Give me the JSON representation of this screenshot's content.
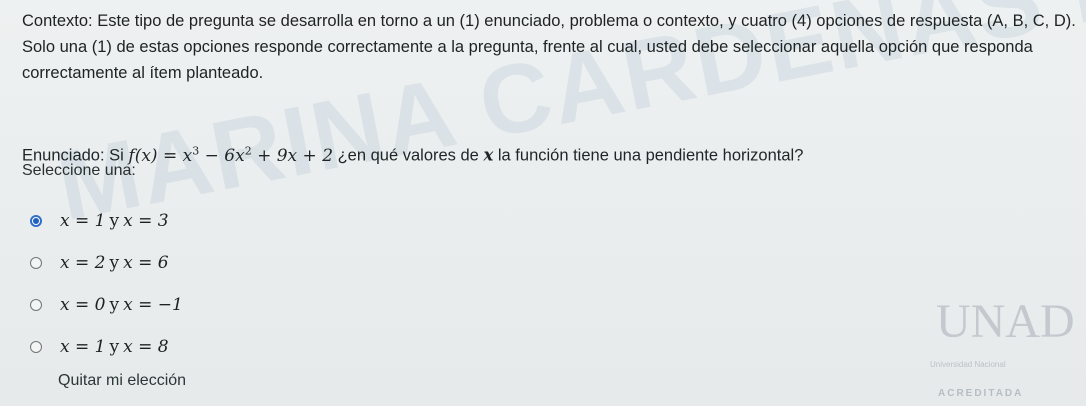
{
  "context": {
    "text": "Contexto: Este tipo de pregunta se desarrolla en torno a un (1) enunciado, problema o contexto, y cuatro (4) opciones de respuesta (A, B, C, D). Solo una (1) de estas opciones responde correctamente a la pregunta, frente al cual, usted debe seleccionar aquella opción que responda correctamente al ítem planteado."
  },
  "enunciado": {
    "label": "Enunciado: Si",
    "function_lhs": "f(x) = ",
    "term1": "x",
    "exp1": "3",
    "term2": " − 6x",
    "exp2": "2",
    "term3": " + 9x + 2",
    "question_pre": " ¿en qué valores de ",
    "question_var": "x",
    "question_post": " la función tiene una pendiente horizontal?"
  },
  "prompt": "Seleccione una:",
  "options": [
    {
      "a": "x = 1",
      "y": "y",
      "b": "x = 3",
      "selected": true
    },
    {
      "a": "x = 2",
      "y": "y",
      "b": "x = 6",
      "selected": false
    },
    {
      "a": "x = 0",
      "y": "y",
      "b": "x = −1",
      "selected": false
    },
    {
      "a": "x = 1",
      "y": "y",
      "b": "x = 8",
      "selected": false
    }
  ],
  "clear_choice": "Quitar mi elección",
  "watermark": "MARINA CARDENAS FIERRO",
  "logo": {
    "mark": "UNAD",
    "subtitle": "Universidad Nacional",
    "accreditation": "ACREDITADA"
  },
  "colors": {
    "radio_selected": "#1f5fc0",
    "text": "#1f2526",
    "background": "#e9ecec"
  }
}
